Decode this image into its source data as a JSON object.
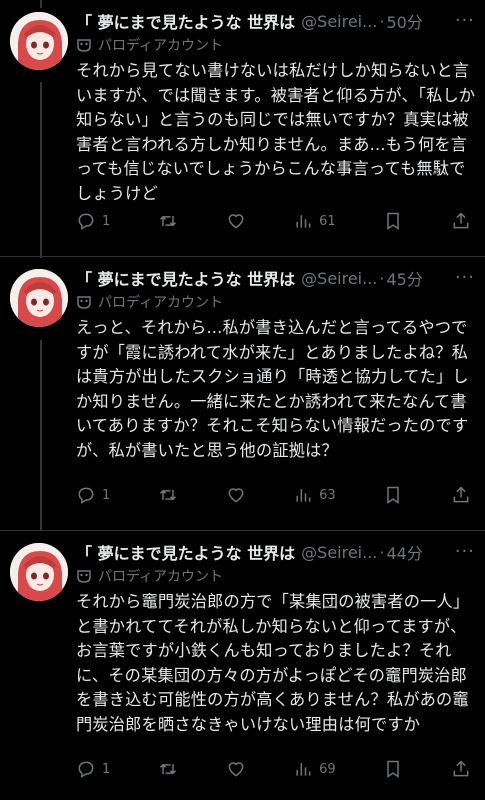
{
  "tweets": [
    {
      "name": "「 夢にまで見たような 世界は",
      "handle": "@Seirei...",
      "time": "50分",
      "label": "パロディアカウント",
      "text": "それから見てない書けないは私だけしか知らないと言いますが、では聞きます。被害者と仰る方が、「私しか知らない」と言うのも同じでは無いですか？真実は被害者と言われる方しか知りません。まあ...もう何を言っても信じないでしょうからこんな事言っても無駄でしょうけど",
      "replies": "1",
      "views": "61"
    },
    {
      "name": "「 夢にまで見たような 世界は",
      "handle": "@Seirei...",
      "time": "45分",
      "label": "パロディアカウント",
      "text": "えっと、それから...私が書き込んだと言ってるやつですが「霞に誘われて水が来た」とありましたよね？私は貴方が出したスクショ通り「時透と協力してた」しか知りません。一緒に来たとか誘われて来たなんて書いてありますか？それこそ知らない情報だったのですが、私が書いたと思う他の証拠は？",
      "replies": "1",
      "views": "63"
    },
    {
      "name": "「 夢にまで見たような 世界は",
      "handle": "@Seirei...",
      "time": "44分",
      "label": "パロディアカウント",
      "text": "それから竈門炭治郎の方で「某集団の被害者の一人」と書かれててそれが私しか知らないと仰ってますが、お言葉ですが小鉄くんも知っておりましたよ？それに、その某集団の方々の方がよっぽどその竈門炭治郎を書き込む可能性の方が高くありません？私があの竈門炭治郎を晒さなきゃいけない理由は何ですか",
      "replies": "1",
      "views": "69"
    }
  ],
  "icons": {
    "reply": "reply-icon",
    "retweet": "retweet-icon",
    "like": "heart-icon",
    "views": "views-icon",
    "bookmark": "bookmark-icon",
    "share": "share-icon",
    "more": "more-icon",
    "parody": "mask-icon"
  },
  "colors": {
    "background": "#000000",
    "text": "#e7e9ea",
    "muted": "#71767b"
  }
}
